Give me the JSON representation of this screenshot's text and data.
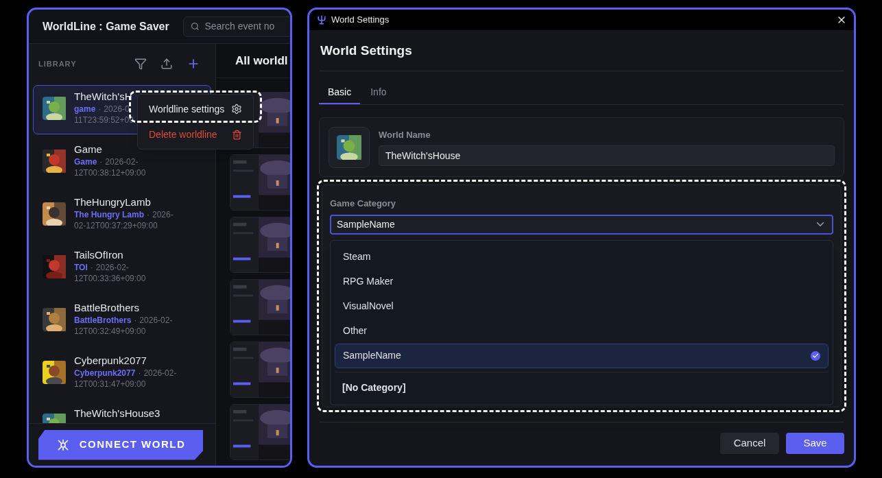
{
  "app": {
    "title": "WorldLine : Game Saver",
    "search": {
      "placeholder": "Search event no"
    }
  },
  "library": {
    "label": "LIBRARY",
    "items": [
      {
        "name": "TheWitch'sH",
        "tag": "game",
        "sep": "·",
        "date": [
          "2026-0",
          "11T23:59:52+09"
        ],
        "selected": true
      },
      {
        "name": "Game",
        "tag": "Game",
        "sep": "·",
        "date": [
          "2026-02-",
          "12T00:38:12+09:00"
        ],
        "selected": false
      },
      {
        "name": "TheHungryLamb",
        "tag": "The Hungry Lamb",
        "sep": "·",
        "date": [
          "2026-",
          "02-12T00:37:29+09:00"
        ],
        "selected": false
      },
      {
        "name": "TailsOfIron",
        "tag": "TOI",
        "sep": "·",
        "date": [
          "2026-02-",
          "12T00:33:36+09:00"
        ],
        "selected": false
      },
      {
        "name": "BattleBrothers",
        "tag": "BattleBrothers",
        "sep": "·",
        "date": [
          "2026-02-",
          "12T00:32:49+09:00"
        ],
        "selected": false
      },
      {
        "name": "Cyberpunk2077",
        "tag": "Cyberpunk2077",
        "sep": "·",
        "date": [
          "2026-02-",
          "12T00:31:47+09:00"
        ],
        "selected": false
      },
      {
        "name": "TheWitch'sHouse3",
        "selected": false
      }
    ]
  },
  "context_menu": {
    "items": [
      {
        "label": "Worldline settings",
        "kind": "settings"
      },
      {
        "label": "Delete worldline",
        "kind": "danger"
      }
    ]
  },
  "connect_button": "CONNECT WORLD",
  "content": {
    "heading": "All worldl"
  },
  "dialog": {
    "window_title": "World Settings",
    "heading": "World Settings",
    "tabs": [
      {
        "label": "Basic",
        "selected": true
      },
      {
        "label": "Info",
        "selected": false
      }
    ],
    "world_name": {
      "label": "World Name",
      "value": "TheWitch'sHouse"
    },
    "category": {
      "label": "Game Category",
      "value": "SampleName",
      "open": true,
      "options": [
        {
          "label": "Steam",
          "selected": false
        },
        {
          "label": "RPG Maker",
          "selected": false
        },
        {
          "label": "VisualNovel",
          "selected": false
        },
        {
          "label": "Other",
          "selected": false
        },
        {
          "label": "SampleName",
          "selected": true
        }
      ],
      "extra_option": "[No Category]"
    },
    "buttons": {
      "cancel": "Cancel",
      "save": "Save"
    }
  }
}
